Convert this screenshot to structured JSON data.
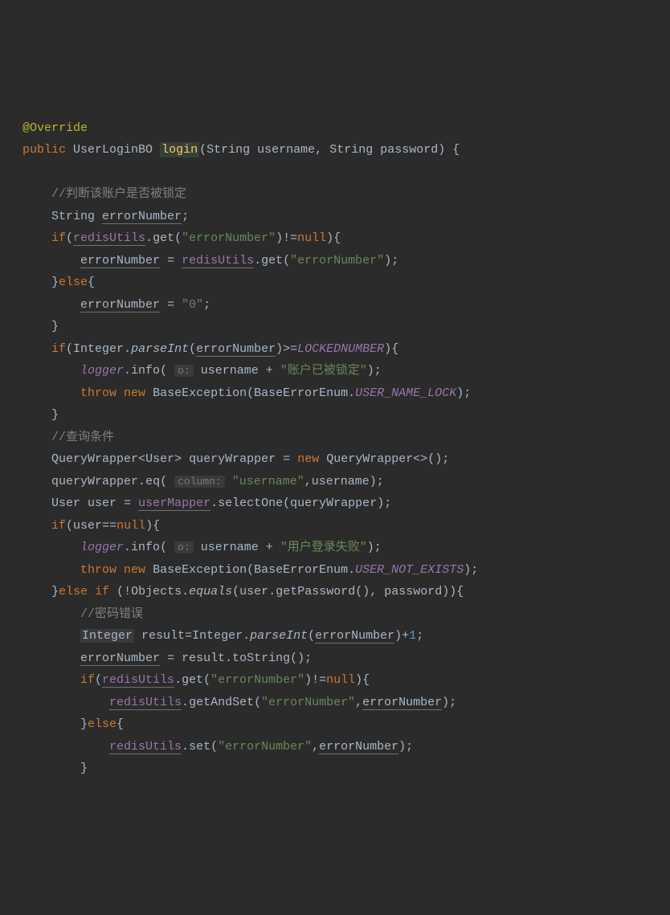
{
  "code": {
    "annotation": "@Override",
    "kw_public": "public",
    "ret_type": "UserLoginBO",
    "method_name": "login",
    "param1_type": "String",
    "param1_name": "username",
    "param2_type": "String",
    "param2_name": "password",
    "comment_lock": "//判断该账户是否被锁定",
    "type_string": "String",
    "var_errorNumber": "errorNumber",
    "kw_if": "if",
    "field_redisUtils": "redisUtils",
    "method_get": "get",
    "str_errorNumber": "\"errorNumber\"",
    "kw_null": "null",
    "method_getAndSet": "getAndSet",
    "method_set": "set",
    "kw_else": "else",
    "str_zero": "\"0\"",
    "type_integer": "Integer",
    "method_parseInt": "parseInt",
    "const_locked": "LOCKEDNUMBER",
    "field_logger": "logger",
    "method_info": "info",
    "hint_o": "o:",
    "str_locked_msg": "\"账户已被锁定\"",
    "kw_throw": "throw",
    "kw_new": "new",
    "type_baseexception": "BaseException",
    "type_baseerrorenum": "BaseErrorEnum",
    "const_user_lock": "USER_NAME_LOCK",
    "comment_query": "//查询条件",
    "type_querywrapper": "QueryWrapper",
    "type_user": "User",
    "var_querywrapper": "queryWrapper",
    "method_eq": "eq",
    "hint_column": "column:",
    "str_username": "\"username\"",
    "var_username": "username",
    "var_user": "user",
    "field_usermapper": "userMapper",
    "method_selectone": "selectOne",
    "str_login_fail": "\"用户登录失败\"",
    "const_user_not_exists": "USER_NOT_EXISTS",
    "type_objects": "Objects",
    "method_equals": "equals",
    "method_getpassword": "getPassword",
    "var_password": "password",
    "comment_pwd": "//密码错误",
    "var_result": "result",
    "num_1": "1",
    "method_tostring": "toString"
  }
}
